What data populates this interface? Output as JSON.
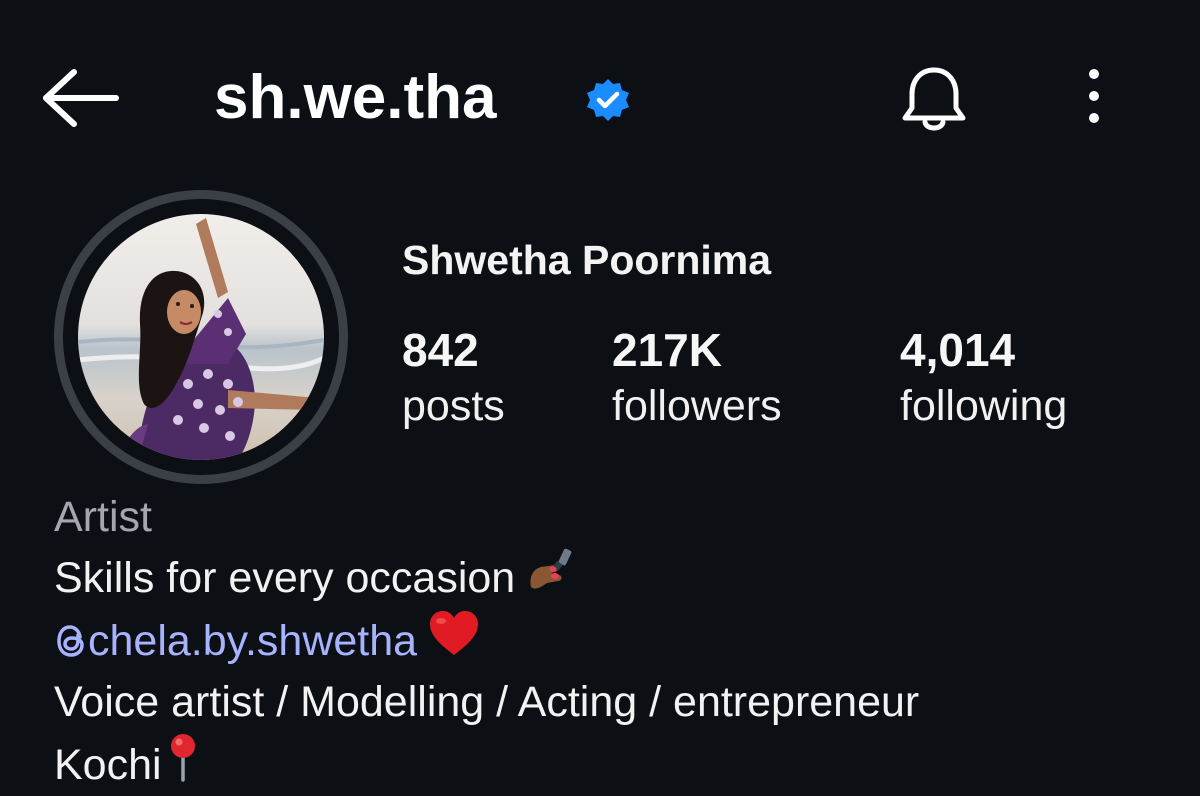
{
  "header": {
    "username": "sh.we.tha",
    "back_icon": "arrow-left-icon",
    "verified_icon": "verified-badge-icon",
    "bell_icon": "bell-icon",
    "more_icon": "more-vertical-icon"
  },
  "profile": {
    "full_name": "Shwetha Poornima",
    "stats": {
      "posts": {
        "value": "842",
        "label": "posts"
      },
      "followers": {
        "value": "217K",
        "label": "followers"
      },
      "following": {
        "value": "4,014",
        "label": "following"
      }
    }
  },
  "bio": {
    "category": "Artist",
    "line1": "Skills for every occasion",
    "threads_handle": "chela.by.shwetha",
    "line3": "Voice artist / Modelling / Acting / entrepreneur",
    "location": "Kochi"
  },
  "colors": {
    "background": "#0c0f14",
    "verified": "#1a8cff",
    "link": "#a8b3ff",
    "category": "#a4a7ad",
    "avatar_ring": "#3b3f46"
  }
}
